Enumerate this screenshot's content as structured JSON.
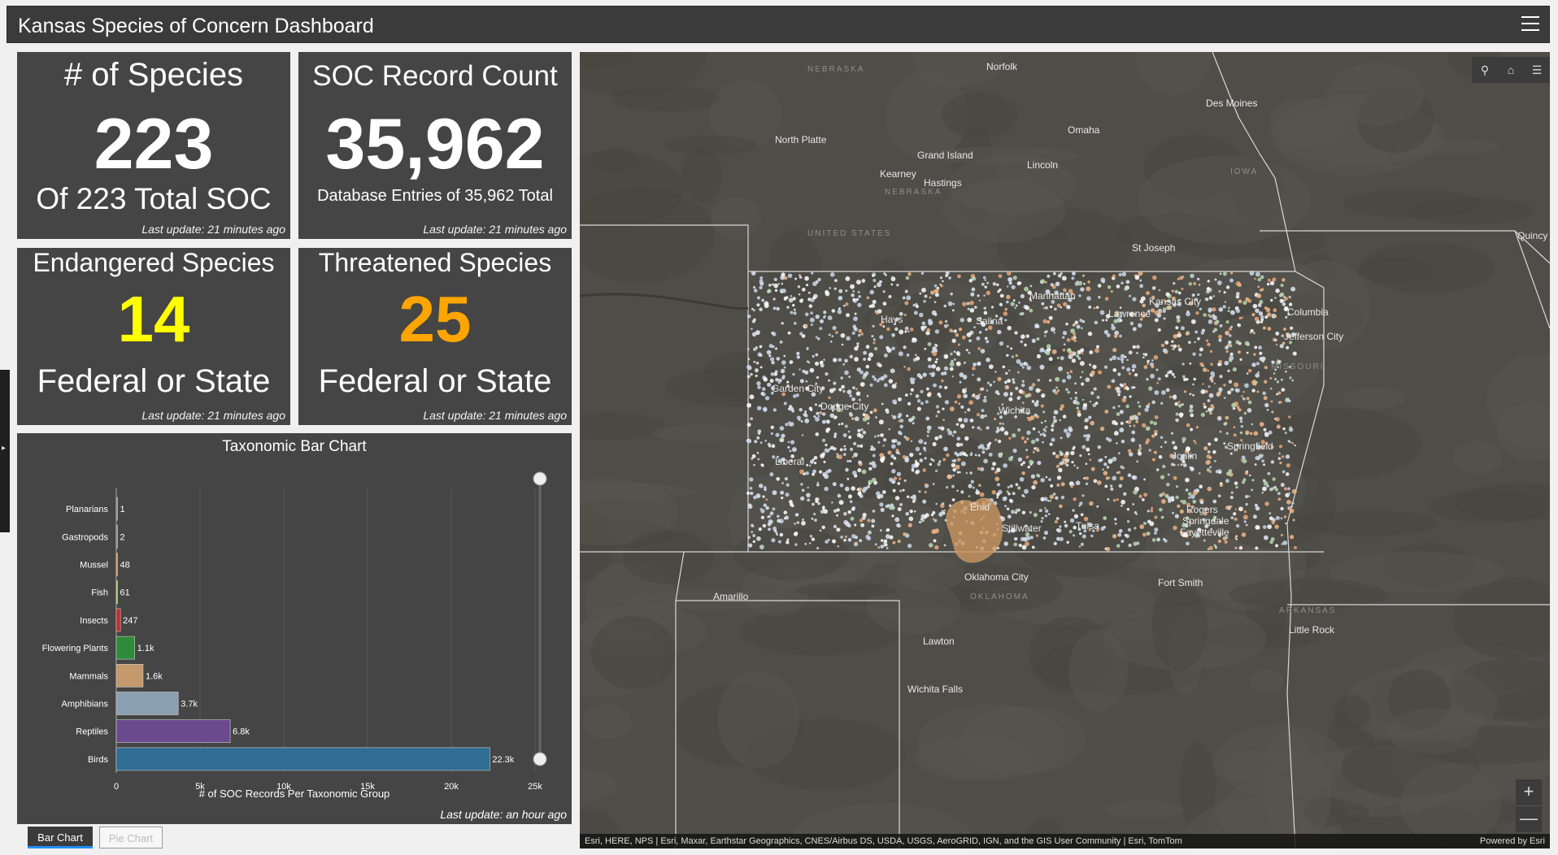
{
  "app": {
    "title": "Kansas Species of Concern Dashboard",
    "menu_icon": "hamburger-menu-icon"
  },
  "cards": {
    "species": {
      "title": "# of Species",
      "value": "223",
      "subtitle": "Of 223 Total SOC",
      "updated": "Last update: 21 minutes ago"
    },
    "records": {
      "title": "SOC Record Count",
      "value": "35,962",
      "subtitle": "Database Entries of 35,962 Total",
      "updated": "Last update: 21 minutes ago"
    },
    "endangered": {
      "title": "Endangered Species",
      "value": "14",
      "subtitle": "Federal or State",
      "updated": "Last update: 21 minutes ago",
      "value_color": "#ffff00"
    },
    "threatened": {
      "title": "Threatened Species",
      "value": "25",
      "subtitle": "Federal or State",
      "updated": "Last update: 21 minutes ago",
      "value_color": "#ffa500"
    }
  },
  "chart_data": {
    "type": "bar",
    "orientation": "horizontal",
    "title": "Taxonomic Bar Chart",
    "xlabel": "# of SOC Records Per Taxonomic Group",
    "ylabel": "",
    "categories": [
      "Planarians",
      "Gastropods",
      "Mussel",
      "Fish",
      "Insects",
      "Flowering Plants",
      "Mammals",
      "Amphibians",
      "Reptiles",
      "Birds"
    ],
    "values": [
      1,
      2,
      48,
      61,
      247,
      1100,
      1600,
      3700,
      6800,
      22300
    ],
    "value_labels": [
      "1",
      "2",
      "48",
      "61",
      "247",
      "1.1k",
      "1.6k",
      "3.7k",
      "6.8k",
      "22.3k"
    ],
    "colors": [
      "#888888",
      "#888888",
      "#e0902a",
      "#9ccf5a",
      "#c8282d",
      "#2e8b3a",
      "#c49a6c",
      "#8aa0b0",
      "#6a4a8c",
      "#2f6d95"
    ],
    "xlim": [
      0,
      25000
    ],
    "xticks": [
      "0",
      "5k",
      "10k",
      "15k",
      "20k",
      "25k"
    ],
    "grid": true,
    "updated": "Last update: an hour ago"
  },
  "tabs": [
    "Bar Chart",
    "Pie Chart"
  ],
  "map": {
    "tools": [
      "search-icon",
      "home-icon",
      "layer-list-icon"
    ],
    "zoom": {
      "in": "+",
      "out": "—"
    },
    "attribution": "Esri, HERE, NPS | Esri, Maxar, Earthstar Geographics, CNES/Airbus DS, USDA, USGS, AeroGRID, IGN, and the GIS User Community | Esri, TomTom",
    "powered_by": "Powered by Esri",
    "regions": [
      "NEBRASKA",
      "NEBRASKA",
      "IOWA",
      "UNITED STATES",
      "MISSOURI",
      "OKLAHOMA",
      "ARKANSAS"
    ],
    "cities": [
      "Norfolk",
      "Des Moines",
      "Omaha",
      "North Platte",
      "Grand Island",
      "Lincoln",
      "Kearney",
      "Hastings",
      "St Joseph",
      "Quincy",
      "Manhattan",
      "Kansas City",
      "Lawrence",
      "Hays",
      "Salina",
      "Columbia",
      "Jefferson City",
      "Garden City",
      "Dodge City",
      "Wichita",
      "Liberal",
      "Joplin",
      "Springfield",
      "Enid",
      "Stillwater",
      "Tulsa",
      "Rogers",
      "Springdale",
      "Fayetteville",
      "Amarillo",
      "Oklahoma City",
      "Fort Smith",
      "Lawton",
      "Little Rock",
      "Wichita Falls"
    ]
  }
}
